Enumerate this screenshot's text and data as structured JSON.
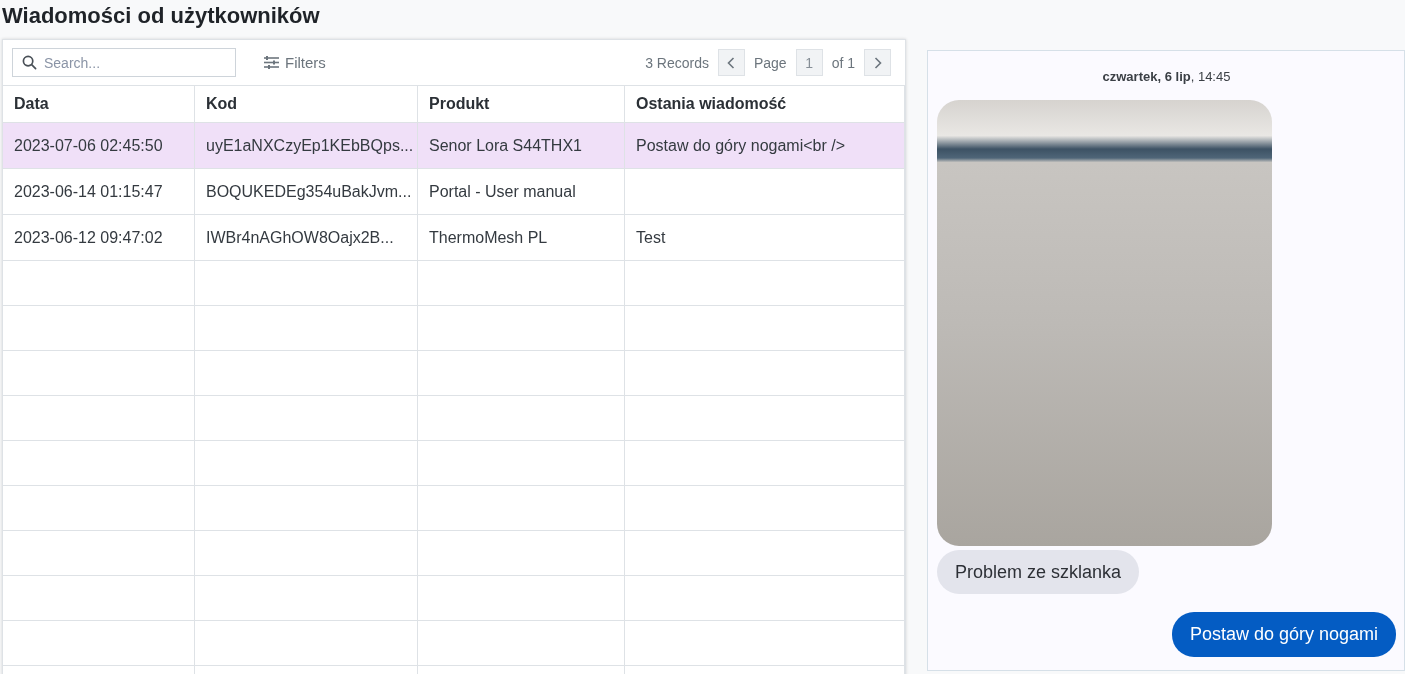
{
  "page_title": "Wiadomości od użytkowników",
  "toolbar": {
    "search": {
      "placeholder": "Search..."
    },
    "filters_label": "Filters",
    "records": "3 Records",
    "page_label": "Page",
    "page_value": "1",
    "page_of": "of 1"
  },
  "table": {
    "columns": [
      "Data",
      "Kod",
      "Produkt",
      "Ostania wiadomość"
    ],
    "rows": [
      {
        "cells": [
          "2023-07-06 02:45:50",
          "uyE1aNXCzyEp1KEbBQps...",
          "Senor Lora S44THX1",
          "Postaw do góry nogami<br />"
        ],
        "selected": true
      },
      {
        "cells": [
          "2023-06-14 01:15:47",
          "BOQUKEDEg354uBakJvm...",
          "Portal - User manual",
          ""
        ],
        "selected": false
      },
      {
        "cells": [
          "2023-06-12 09:47:02",
          "IWBr4nAGhOW8Oajx2B...",
          "ThermoMesh PL",
          "Test"
        ],
        "selected": false
      }
    ]
  },
  "chat": {
    "date_header": "**czwartek, 6 lip**, 14:45",
    "messages": [
      {
        "kind": "image"
      },
      {
        "kind": "received",
        "text": "Problem ze szklanka"
      },
      {
        "kind": "sent",
        "text": "Postaw do góry nogami"
      }
    ]
  }
}
